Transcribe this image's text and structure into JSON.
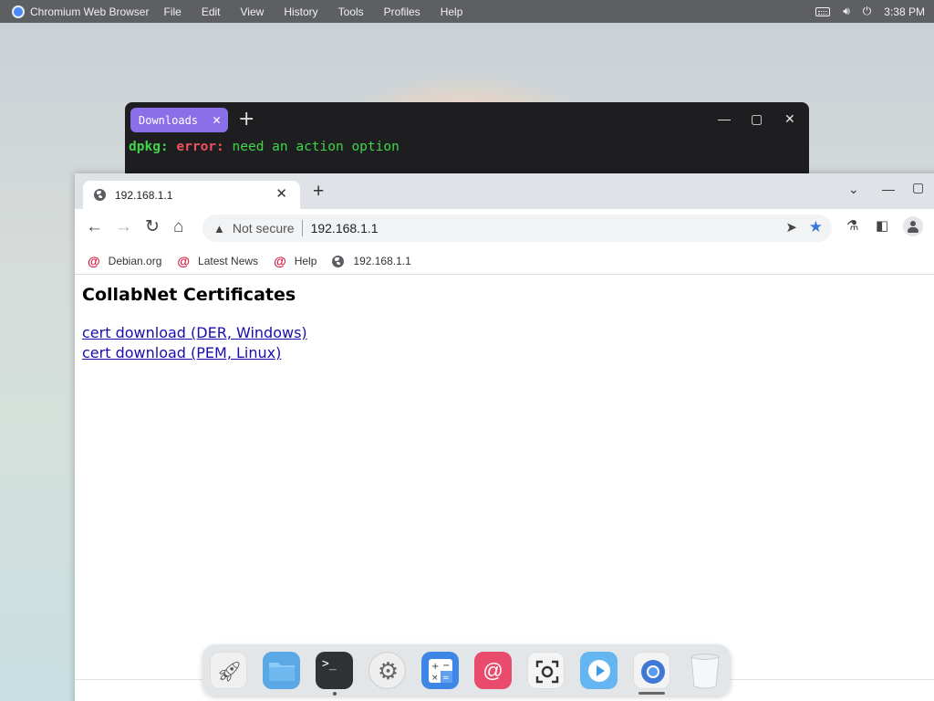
{
  "topbar": {
    "app_name": "Chromium Web Browser",
    "menus": [
      "File",
      "Edit",
      "View",
      "History",
      "Tools",
      "Profiles",
      "Help"
    ],
    "clock": "3:38 PM"
  },
  "terminal": {
    "tab_label": "Downloads",
    "output": {
      "prefix": "dpkg:",
      "error_word": "error:",
      "message": " need an action option"
    }
  },
  "browser": {
    "tab_title": "192.168.1.1",
    "security_label": "Not secure",
    "url": "192.168.1.1",
    "bookmarks": [
      {
        "label": "Debian.org",
        "icon": "debian-swirl-icon"
      },
      {
        "label": "Latest News",
        "icon": "debian-swirl-icon"
      },
      {
        "label": "Help",
        "icon": "debian-swirl-icon"
      },
      {
        "label": "192.168.1.1",
        "icon": "globe-icon"
      }
    ],
    "page": {
      "heading": "CollabNet Certificates",
      "links": [
        "cert download (DER, Windows)",
        "cert download (PEM, Linux)"
      ]
    }
  },
  "dock": {
    "apps": [
      "launcher",
      "files",
      "terminal",
      "settings",
      "calculator",
      "debian",
      "screenshot",
      "media-player",
      "chromium",
      "trash"
    ]
  },
  "colors": {
    "accent_tab": "#8b6fe8",
    "link": "#1a0dab",
    "terminal_green": "#3fd64a",
    "terminal_red": "#f0525b"
  }
}
